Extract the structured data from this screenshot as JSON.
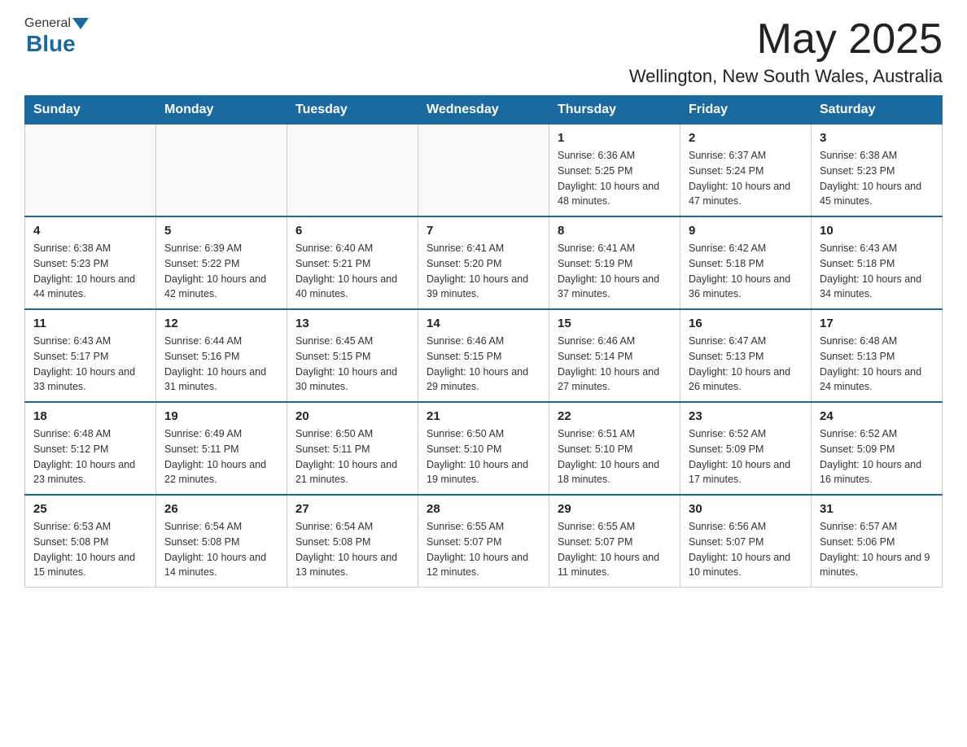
{
  "header": {
    "logo_general": "General",
    "logo_blue": "Blue",
    "main_title": "May 2025",
    "subtitle": "Wellington, New South Wales, Australia"
  },
  "days_of_week": [
    "Sunday",
    "Monday",
    "Tuesday",
    "Wednesday",
    "Thursday",
    "Friday",
    "Saturday"
  ],
  "weeks": [
    [
      {
        "day": "",
        "info": ""
      },
      {
        "day": "",
        "info": ""
      },
      {
        "day": "",
        "info": ""
      },
      {
        "day": "",
        "info": ""
      },
      {
        "day": "1",
        "info": "Sunrise: 6:36 AM\nSunset: 5:25 PM\nDaylight: 10 hours and 48 minutes."
      },
      {
        "day": "2",
        "info": "Sunrise: 6:37 AM\nSunset: 5:24 PM\nDaylight: 10 hours and 47 minutes."
      },
      {
        "day": "3",
        "info": "Sunrise: 6:38 AM\nSunset: 5:23 PM\nDaylight: 10 hours and 45 minutes."
      }
    ],
    [
      {
        "day": "4",
        "info": "Sunrise: 6:38 AM\nSunset: 5:23 PM\nDaylight: 10 hours and 44 minutes."
      },
      {
        "day": "5",
        "info": "Sunrise: 6:39 AM\nSunset: 5:22 PM\nDaylight: 10 hours and 42 minutes."
      },
      {
        "day": "6",
        "info": "Sunrise: 6:40 AM\nSunset: 5:21 PM\nDaylight: 10 hours and 40 minutes."
      },
      {
        "day": "7",
        "info": "Sunrise: 6:41 AM\nSunset: 5:20 PM\nDaylight: 10 hours and 39 minutes."
      },
      {
        "day": "8",
        "info": "Sunrise: 6:41 AM\nSunset: 5:19 PM\nDaylight: 10 hours and 37 minutes."
      },
      {
        "day": "9",
        "info": "Sunrise: 6:42 AM\nSunset: 5:18 PM\nDaylight: 10 hours and 36 minutes."
      },
      {
        "day": "10",
        "info": "Sunrise: 6:43 AM\nSunset: 5:18 PM\nDaylight: 10 hours and 34 minutes."
      }
    ],
    [
      {
        "day": "11",
        "info": "Sunrise: 6:43 AM\nSunset: 5:17 PM\nDaylight: 10 hours and 33 minutes."
      },
      {
        "day": "12",
        "info": "Sunrise: 6:44 AM\nSunset: 5:16 PM\nDaylight: 10 hours and 31 minutes."
      },
      {
        "day": "13",
        "info": "Sunrise: 6:45 AM\nSunset: 5:15 PM\nDaylight: 10 hours and 30 minutes."
      },
      {
        "day": "14",
        "info": "Sunrise: 6:46 AM\nSunset: 5:15 PM\nDaylight: 10 hours and 29 minutes."
      },
      {
        "day": "15",
        "info": "Sunrise: 6:46 AM\nSunset: 5:14 PM\nDaylight: 10 hours and 27 minutes."
      },
      {
        "day": "16",
        "info": "Sunrise: 6:47 AM\nSunset: 5:13 PM\nDaylight: 10 hours and 26 minutes."
      },
      {
        "day": "17",
        "info": "Sunrise: 6:48 AM\nSunset: 5:13 PM\nDaylight: 10 hours and 24 minutes."
      }
    ],
    [
      {
        "day": "18",
        "info": "Sunrise: 6:48 AM\nSunset: 5:12 PM\nDaylight: 10 hours and 23 minutes."
      },
      {
        "day": "19",
        "info": "Sunrise: 6:49 AM\nSunset: 5:11 PM\nDaylight: 10 hours and 22 minutes."
      },
      {
        "day": "20",
        "info": "Sunrise: 6:50 AM\nSunset: 5:11 PM\nDaylight: 10 hours and 21 minutes."
      },
      {
        "day": "21",
        "info": "Sunrise: 6:50 AM\nSunset: 5:10 PM\nDaylight: 10 hours and 19 minutes."
      },
      {
        "day": "22",
        "info": "Sunrise: 6:51 AM\nSunset: 5:10 PM\nDaylight: 10 hours and 18 minutes."
      },
      {
        "day": "23",
        "info": "Sunrise: 6:52 AM\nSunset: 5:09 PM\nDaylight: 10 hours and 17 minutes."
      },
      {
        "day": "24",
        "info": "Sunrise: 6:52 AM\nSunset: 5:09 PM\nDaylight: 10 hours and 16 minutes."
      }
    ],
    [
      {
        "day": "25",
        "info": "Sunrise: 6:53 AM\nSunset: 5:08 PM\nDaylight: 10 hours and 15 minutes."
      },
      {
        "day": "26",
        "info": "Sunrise: 6:54 AM\nSunset: 5:08 PM\nDaylight: 10 hours and 14 minutes."
      },
      {
        "day": "27",
        "info": "Sunrise: 6:54 AM\nSunset: 5:08 PM\nDaylight: 10 hours and 13 minutes."
      },
      {
        "day": "28",
        "info": "Sunrise: 6:55 AM\nSunset: 5:07 PM\nDaylight: 10 hours and 12 minutes."
      },
      {
        "day": "29",
        "info": "Sunrise: 6:55 AM\nSunset: 5:07 PM\nDaylight: 10 hours and 11 minutes."
      },
      {
        "day": "30",
        "info": "Sunrise: 6:56 AM\nSunset: 5:07 PM\nDaylight: 10 hours and 10 minutes."
      },
      {
        "day": "31",
        "info": "Sunrise: 6:57 AM\nSunset: 5:06 PM\nDaylight: 10 hours and 9 minutes."
      }
    ]
  ]
}
